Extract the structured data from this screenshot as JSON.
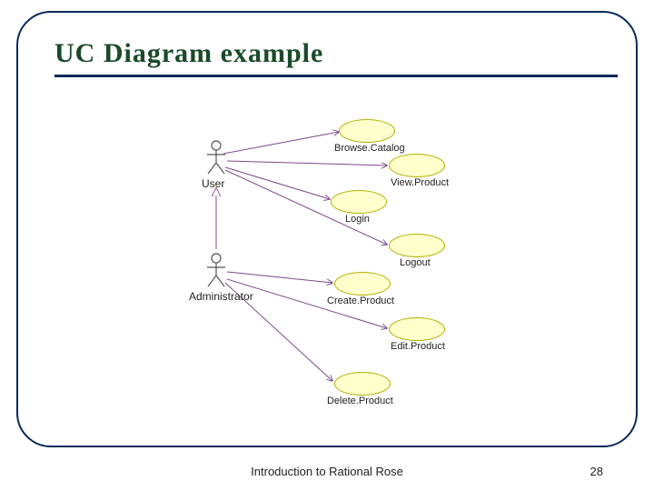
{
  "slide": {
    "title": "UC Diagram example",
    "footer": "Introduction to Rational Rose",
    "page_number": "28"
  },
  "diagram": {
    "actors": [
      {
        "id": "user",
        "label": "User"
      },
      {
        "id": "admin",
        "label": "Administrator"
      }
    ],
    "usecases": [
      {
        "id": "browse",
        "label": "Browse.Catalog"
      },
      {
        "id": "view",
        "label": "View.Product"
      },
      {
        "id": "login",
        "label": "Login"
      },
      {
        "id": "logout",
        "label": "Logout"
      },
      {
        "id": "create",
        "label": "Create.Product"
      },
      {
        "id": "edit",
        "label": "Edit.Product"
      },
      {
        "id": "delete",
        "label": "Delete.Product"
      }
    ],
    "relations": [
      {
        "from": "user",
        "to": "browse",
        "kind": "assoc"
      },
      {
        "from": "user",
        "to": "view",
        "kind": "assoc"
      },
      {
        "from": "user",
        "to": "login",
        "kind": "assoc"
      },
      {
        "from": "user",
        "to": "logout",
        "kind": "assoc"
      },
      {
        "from": "admin",
        "to": "user",
        "kind": "generalize"
      },
      {
        "from": "admin",
        "to": "create",
        "kind": "assoc"
      },
      {
        "from": "admin",
        "to": "edit",
        "kind": "assoc"
      },
      {
        "from": "admin",
        "to": "delete",
        "kind": "assoc"
      }
    ]
  }
}
